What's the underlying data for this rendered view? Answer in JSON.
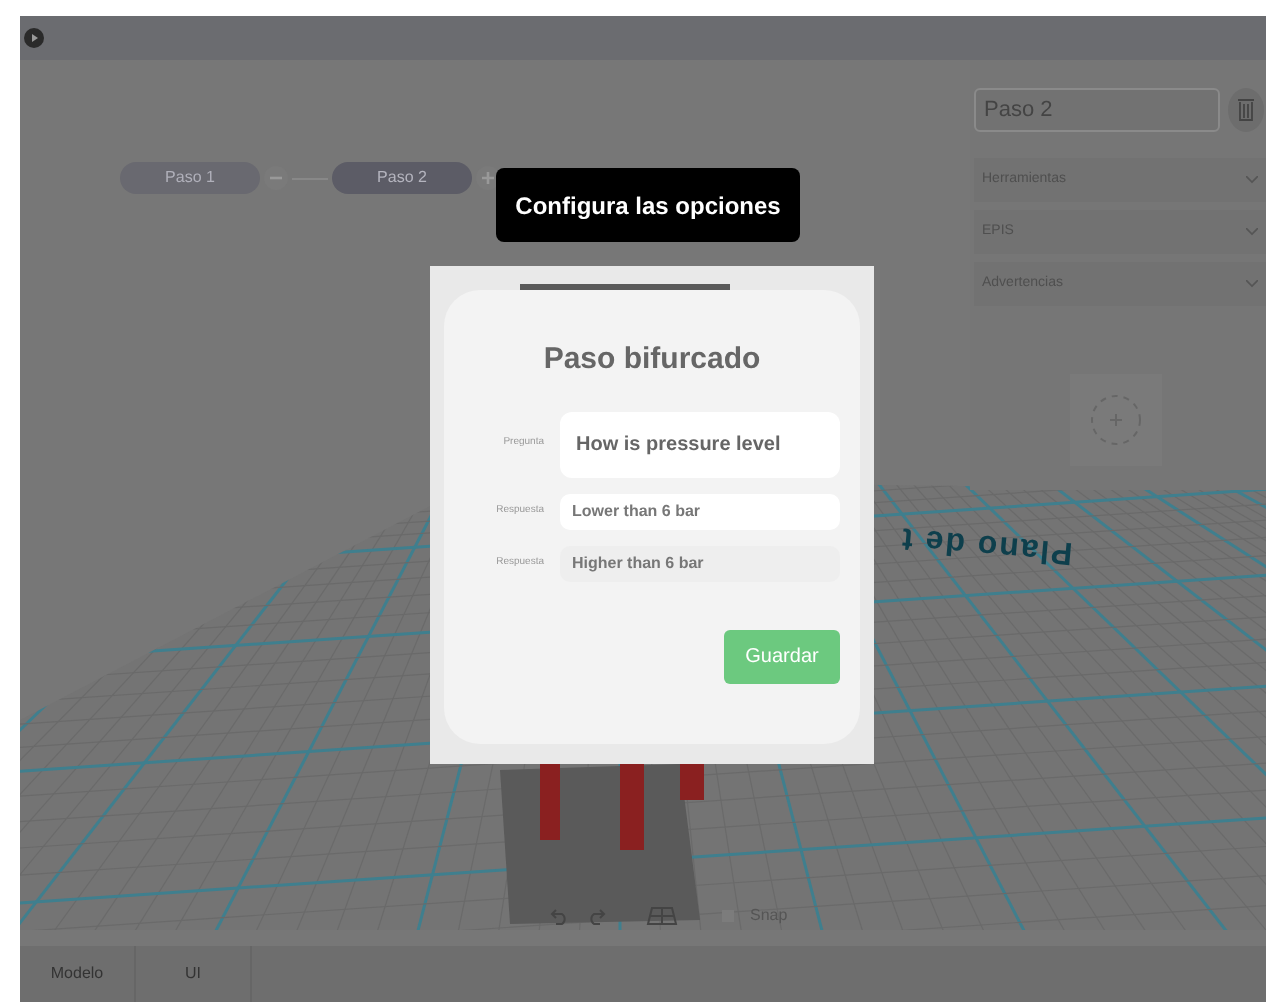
{
  "steps": [
    {
      "label": "Paso 1",
      "selected": false
    },
    {
      "label": "Paso 2",
      "selected": true
    }
  ],
  "floor_label": "Plano de t",
  "tooltip": "Configura las opciones",
  "dialog": {
    "title": "Paso bifurcado",
    "question": {
      "label": "Pregunta",
      "value": "How is pressure level"
    },
    "answers": [
      {
        "label": "Respuesta",
        "value": "Lower than 6 bar",
        "active": true
      },
      {
        "label": "Respuesta",
        "value": "Higher than 6 bar",
        "active": false
      }
    ],
    "save_button": "Guardar"
  },
  "panel": {
    "name_field": "Paso 2",
    "sections": [
      {
        "label": "Herramientas",
        "expanded": false
      },
      {
        "label": "EPIS",
        "expanded": false
      },
      {
        "label": "Advertencias",
        "expanded": false
      }
    ]
  },
  "toolbar": {
    "snap": {
      "label": "Snap",
      "checked": false
    }
  },
  "bottom_tabs": [
    {
      "label": "Modelo"
    },
    {
      "label": "UI"
    }
  ]
}
